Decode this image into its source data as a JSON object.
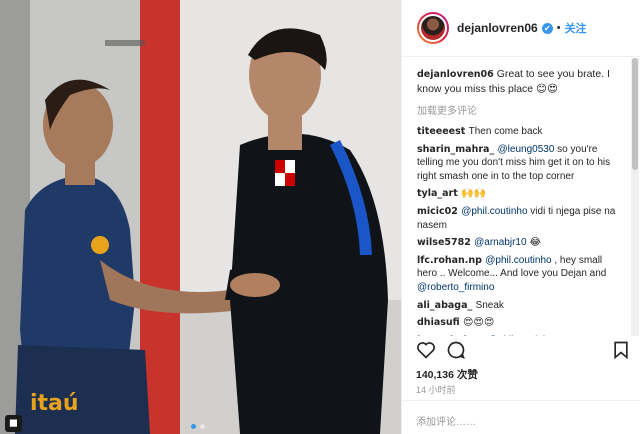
{
  "post": {
    "username": "dejanlovren06",
    "follow_label": "关注",
    "verified_glyph": "✔",
    "caption_text": "Great to see you brate. I know you miss this place 😊😍",
    "load_more": "加载更多评论",
    "likes": "140,136 次赞",
    "time": "14 小时前",
    "add_comment_placeholder": "添加评论……"
  },
  "photo": {
    "left_shirt_text": "itaú",
    "crest_colors": [
      "#cc0000",
      "#ffffff"
    ],
    "shirt_colors": {
      "left": "#1f3a66",
      "right": "#101418",
      "accent": "#e8a21c",
      "stripe": "#1a56c8"
    }
  },
  "comments": [
    {
      "user": "titeeeest",
      "text": "Then come back"
    },
    {
      "user": "sharin_mahra_",
      "parts": [
        {
          "m": "@leung0530"
        },
        {
          "t": " so you're telling me you don't miss him get it on to his right smash one in to the top corner"
        }
      ]
    },
    {
      "user": "tyla_art",
      "text": "🙌🙌"
    },
    {
      "user": "micic02",
      "parts": [
        {
          "m": "@phil.coutinho"
        },
        {
          "t": " vidi ti njega pise na nasem"
        }
      ]
    },
    {
      "user": "wilse5782",
      "parts": [
        {
          "m": "@arnabjr10"
        },
        {
          "t": " 😂"
        }
      ]
    },
    {
      "user": "lfc.rohan.np",
      "parts": [
        {
          "m": "@phil.coutinho"
        },
        {
          "t": " , hey small hero .. Welcome... And love you Dejan and "
        },
        {
          "m": "@roberto_firmino"
        }
      ]
    },
    {
      "user": "ali_abaga_",
      "text": "Sneak"
    },
    {
      "user": "dhiasufi",
      "text": "😍😍😍"
    },
    {
      "user": "kwgreindeer",
      "parts": [
        {
          "m": "@phil.coutinho"
        },
        {
          "t": " "
        },
        {
          "m": "#YNWA"
        },
        {
          "t": " ❤"
        }
      ]
    }
  ]
}
